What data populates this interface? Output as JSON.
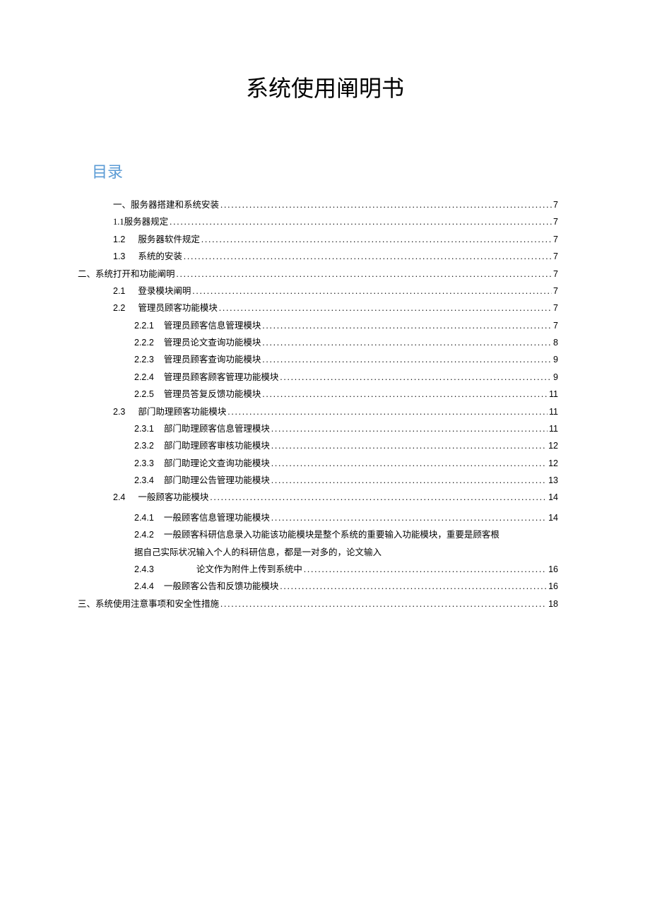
{
  "title": "系统使用阐明书",
  "toc_heading": "目录",
  "toc": {
    "s1": {
      "num": "一、",
      "label": "服务器搭建和系统安装",
      "page": "7"
    },
    "s1_1": {
      "num": "1.1",
      "label": "服务器规定",
      "page": "7"
    },
    "s1_2": {
      "num": "1.2",
      "label": "服务器软件规定",
      "page": "7"
    },
    "s1_3": {
      "num": "1.3",
      "label": "系统的安装",
      "page": "7"
    },
    "s2": {
      "num": "二、",
      "label": "系统打开和功能阐明",
      "page": "7"
    },
    "s2_1": {
      "num": "2.1",
      "label": "登录模块阐明",
      "page": "7"
    },
    "s2_2": {
      "num": "2.2",
      "label": "管理员顾客功能模块",
      "page": "7"
    },
    "s2_2_1": {
      "num": "2.2.1",
      "label": "管理员顾客信息管理模块",
      "page": "7"
    },
    "s2_2_2": {
      "num": "2.2.2",
      "label": "管理员论文查询功能模块",
      "page": "8"
    },
    "s2_2_3": {
      "num": "2.2.3",
      "label": "管理员顾客查询功能模块",
      "page": "9"
    },
    "s2_2_4": {
      "num": "2.2.4",
      "label": "管理员顾客顾客管理功能模块",
      "page": "9"
    },
    "s2_2_5": {
      "num": "2.2.5",
      "label": "管理员答复反馈功能模块",
      "page": "11"
    },
    "s2_3": {
      "num": "2.3",
      "label": "部门助理顾客功能模块",
      "page": "11"
    },
    "s2_3_1": {
      "num": "2.3.1",
      "label": "部门助理顾客信息管理模块",
      "page": "11"
    },
    "s2_3_2": {
      "num": "2.3.2",
      "label": "部门助理顾客审核功能模块",
      "page": "12"
    },
    "s2_3_3": {
      "num": "2.3.3",
      "label": "部门助理论文查询功能模块",
      "page": "12"
    },
    "s2_3_4": {
      "num": "2.3.4",
      "label": "部门助理公告管理功能模块",
      "page": "13"
    },
    "s2_4": {
      "num": "2.4",
      "label": "一般顾客功能模块",
      "page": "14"
    },
    "s2_4_1": {
      "num": "2.4.1",
      "label": "一般顾客信息管理功能模块",
      "page": "14"
    },
    "s2_4_2": {
      "num": "2.4.2",
      "label_a": "一般顾客科研信息录入功能该功能模块是整个系统的重要输入功能模块，重要是顾客根",
      "label_b": "据自己实际状况输入个人的科研信息，都是一对多的，论文输入"
    },
    "s2_4_3": {
      "num": "2.4.3",
      "label": "论文作为附件上传到系统中",
      "page": "16"
    },
    "s2_4_4": {
      "num": "2.4.4",
      "label": "一般顾客公告和反馈功能模块",
      "page": "16"
    },
    "s3": {
      "num": "三、",
      "label": "系统使用注意事项和安全性措施",
      "page": "18"
    }
  }
}
